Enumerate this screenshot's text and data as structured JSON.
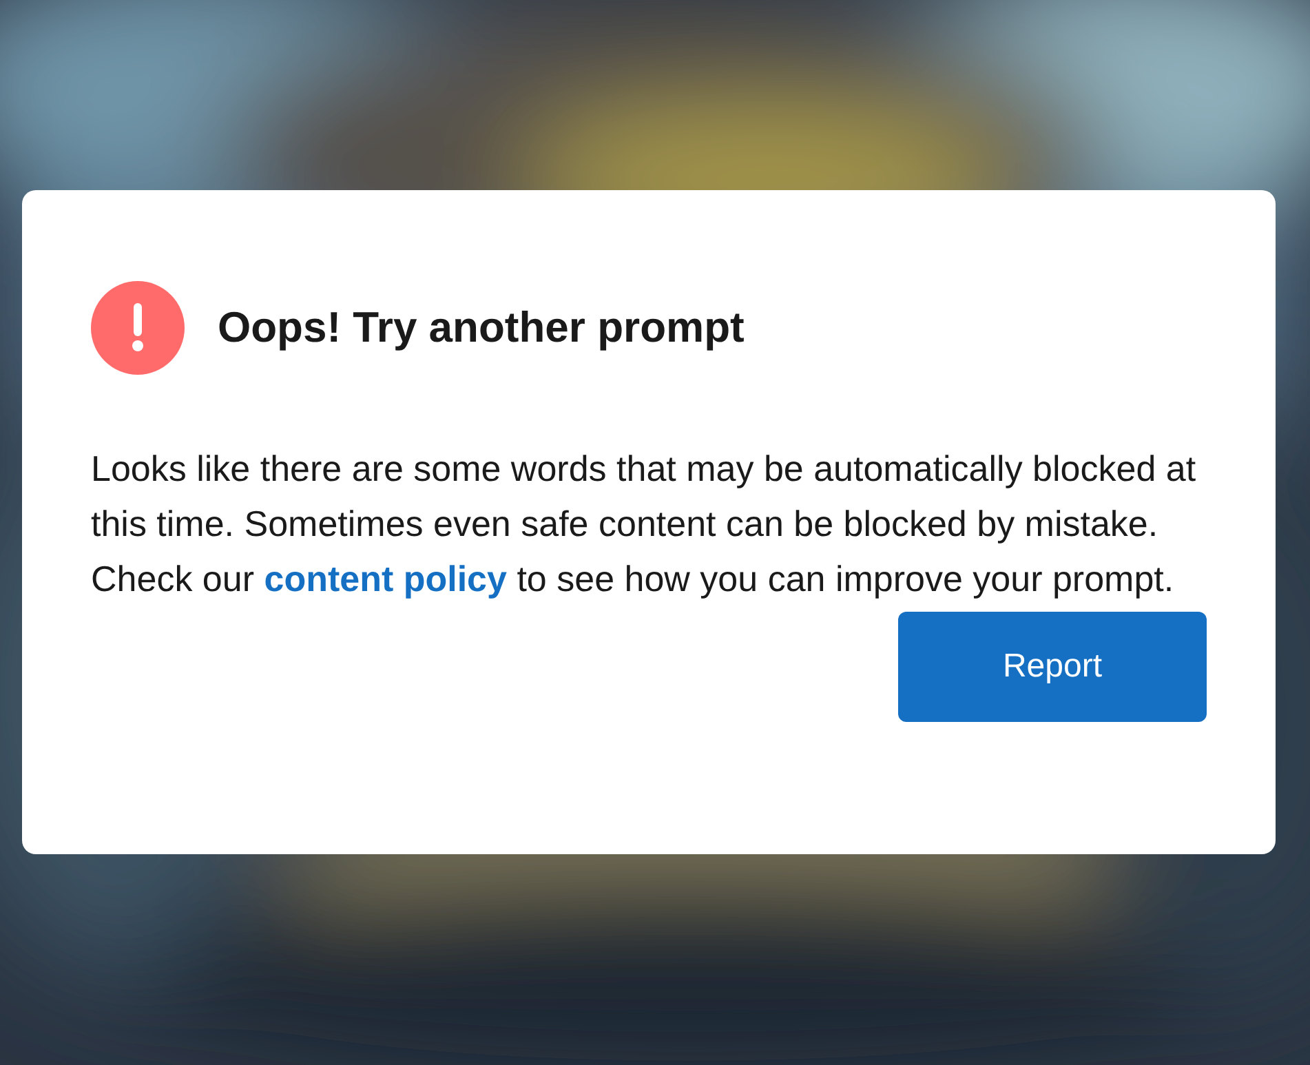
{
  "dialog": {
    "title": "Oops! Try another prompt",
    "message": {
      "before": "Looks like there are some words that may be automatically blocked at this time. Sometimes even safe content can be blocked by mistake. Check our ",
      "link": "content policy",
      "after": " to see how you can improve your prompt."
    },
    "buttons": [
      "Report"
    ]
  }
}
